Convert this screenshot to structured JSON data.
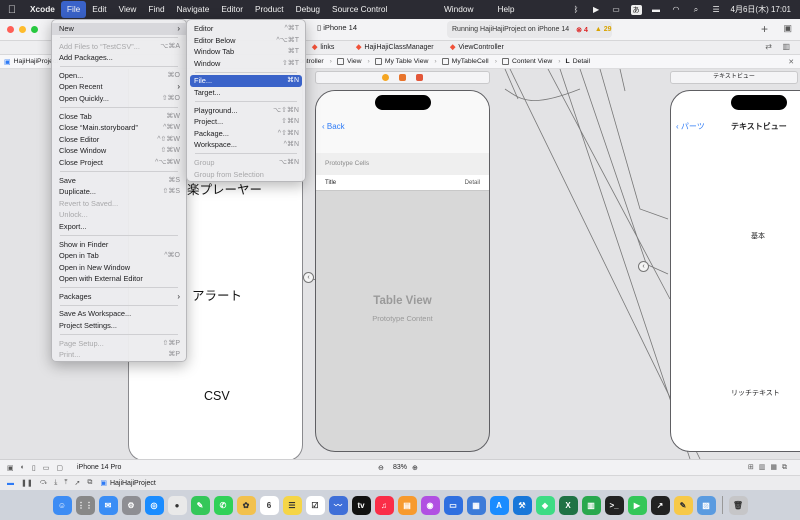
{
  "menubar": {
    "app_name": "Xcode",
    "items": [
      "File",
      "Edit",
      "View",
      "Find",
      "Navigate",
      "Editor",
      "Product",
      "Debug",
      "Source Control"
    ],
    "extra": [
      "Window",
      "Help"
    ],
    "ime": "あ",
    "clock": "4月6日(木) 17:01"
  },
  "toolbar": {
    "device": "iPhone 14",
    "status": "Running HajiHajiProject on iPhone 14",
    "errors": "4",
    "warnings": "29",
    "plus": "+"
  },
  "tabs": [
    "links",
    "HajiHajiClassManager",
    "ViewController"
  ],
  "jumpbar": [
    "HajiHajiProject",
    "Controller",
    "View",
    "My Table View",
    "MyTableCell",
    "Content View",
    "Detail"
  ],
  "left_scene": {
    "labels": [
      "楽プレーヤー",
      "アラート",
      "CSV"
    ]
  },
  "phone": {
    "back": "Back",
    "section": "Prototype Cells",
    "cell_title": "Title",
    "cell_detail": "Detail",
    "title": "Table View",
    "subtitle": "Prototype Content"
  },
  "right_scene": {
    "header": "テキストビュー",
    "back": "パーツ",
    "title": "テキストビュー",
    "label1": "基本",
    "label2": "リッチテキスト"
  },
  "debugbar": {
    "device": "iPhone 14 Pro",
    "zoom": "83%"
  },
  "statusbar": {
    "project": "HajiHajiProject"
  },
  "file_menu": [
    {
      "label": "New",
      "submenu": true
    },
    {
      "sep": true
    },
    {
      "label": "Add Files to “TestCSV”...",
      "shortcut": "⌥⌘A",
      "disabled": true
    },
    {
      "label": "Add Packages..."
    },
    {
      "sep": true
    },
    {
      "label": "Open...",
      "shortcut": "⌘O"
    },
    {
      "label": "Open Recent",
      "submenu": true
    },
    {
      "label": "Open Quickly...",
      "shortcut": "⇧⌘O"
    },
    {
      "sep": true
    },
    {
      "label": "Close Tab",
      "shortcut": "⌘W"
    },
    {
      "label": "Close “Main.storyboard”",
      "shortcut": "^⌘W"
    },
    {
      "label": "Close Editor",
      "shortcut": "^⇧⌘W"
    },
    {
      "label": "Close Window",
      "shortcut": "⇧⌘W"
    },
    {
      "label": "Close Project",
      "shortcut": "^⌥⌘W"
    },
    {
      "sep": true
    },
    {
      "label": "Save",
      "shortcut": "⌘S"
    },
    {
      "label": "Duplicate...",
      "shortcut": "⇧⌘S"
    },
    {
      "label": "Revert to Saved...",
      "disabled": true
    },
    {
      "label": "Unlock...",
      "disabled": true
    },
    {
      "label": "Export..."
    },
    {
      "sep": true
    },
    {
      "label": "Show in Finder"
    },
    {
      "label": "Open in Tab",
      "shortcut": "^⌘O"
    },
    {
      "label": "Open in New Window"
    },
    {
      "label": "Open with External Editor"
    },
    {
      "sep": true
    },
    {
      "label": "Packages",
      "submenu": true
    },
    {
      "sep": true
    },
    {
      "label": "Save As Workspace..."
    },
    {
      "label": "Project Settings..."
    },
    {
      "sep": true
    },
    {
      "label": "Page Setup...",
      "shortcut": "⇧⌘P",
      "disabled": true
    },
    {
      "label": "Print...",
      "shortcut": "⌘P",
      "disabled": true
    }
  ],
  "new_submenu": [
    {
      "label": "Editor",
      "shortcut": "^⌘T"
    },
    {
      "label": "Editor Below",
      "shortcut": "^⌥⌘T"
    },
    {
      "label": "Window Tab",
      "shortcut": "⌘T"
    },
    {
      "label": "Window",
      "shortcut": "⇧⌘T"
    },
    {
      "sep": true
    },
    {
      "label": "File...",
      "shortcut": "⌘N",
      "highlighted": true
    },
    {
      "label": "Target..."
    },
    {
      "sep": true
    },
    {
      "label": "Playground...",
      "shortcut": "⌥⇧⌘N"
    },
    {
      "label": "Project...",
      "shortcut": "⇧⌘N"
    },
    {
      "label": "Package...",
      "shortcut": "^⇧⌘N"
    },
    {
      "label": "Workspace...",
      "shortcut": "^⌘N"
    },
    {
      "sep": true
    },
    {
      "label": "Group",
      "shortcut": "⌥⌘N",
      "disabled": true
    },
    {
      "label": "Group from Selection",
      "disabled": true
    }
  ],
  "dock_icons": [
    "finder-icon",
    "launchpad-icon",
    "mail-icon",
    "settings-icon",
    "safari-icon",
    "chrome-icon",
    "messages-icon",
    "facetime-icon",
    "photos-icon",
    "calendar-icon",
    "notes-icon",
    "reminders-icon",
    "freeform-icon",
    "appletv-icon",
    "music-icon",
    "books-icon",
    "podcasts-icon",
    "keynote-icon",
    "files-icon",
    "appstore-icon",
    "xcode-icon",
    "android-studio-icon",
    "excel-icon",
    "numbers-icon",
    "terminal-icon",
    "facetime-video-icon",
    "stocks-icon",
    "notes-app-icon",
    "preview-icon",
    "trash-icon"
  ],
  "colors": {
    "accent": "#3a63c9",
    "menubar_bg": "#2b2b33",
    "link_blue": "#2e7bf6"
  }
}
